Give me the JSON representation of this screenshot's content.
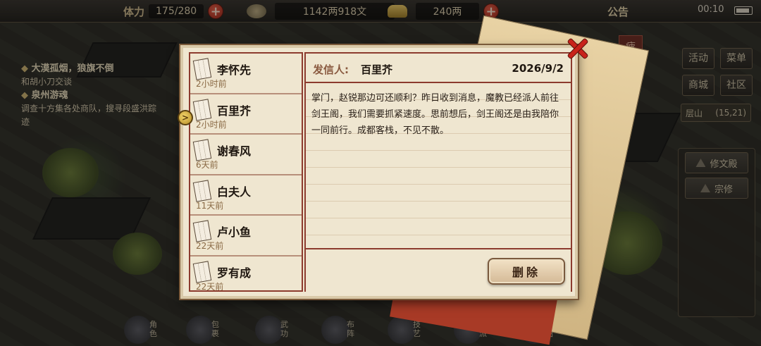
{
  "topbar": {
    "stamina_label": "体力",
    "stamina_value": "175/280",
    "money_value": "1142两918文",
    "gold_value": "240两",
    "notice_label": "公告",
    "clock": "00:10"
  },
  "quests": [
    {
      "title": "大漠孤烟，狼旗不倒",
      "desc": "和胡小刀交谈"
    },
    {
      "title": "泉州游魂",
      "desc": "调查十方集各处商队，搜寻段盛洪踪迹"
    }
  ],
  "right_menu": {
    "fatigue": "疲",
    "activity": "活动",
    "menu": "菜单",
    "shop": "商城",
    "community": "社区",
    "location_name": "层山",
    "location_coords": "(15,21)",
    "build_hall": "修文殿",
    "sect_cultivate": "宗修"
  },
  "bottom_nav": [
    {
      "label": "角色"
    },
    {
      "label": "包裹"
    },
    {
      "label": "武功"
    },
    {
      "label": "布阵"
    },
    {
      "label": "技艺"
    },
    {
      "label": "门派"
    },
    {
      "label": "地图"
    }
  ],
  "mail": {
    "list": [
      {
        "sender": "李怀先",
        "time": "2小时前"
      },
      {
        "sender": "百里芥",
        "time": "2小时前"
      },
      {
        "sender": "谢春风",
        "time": "6天前"
      },
      {
        "sender": "白夫人",
        "time": "11天前"
      },
      {
        "sender": "卢小鱼",
        "time": "22天前"
      },
      {
        "sender": "罗有成",
        "time": "22天前"
      }
    ],
    "selected_index": 1,
    "detail": {
      "sender_label": "发信人:",
      "sender_name": "百里芥",
      "date": "2026/9/2",
      "body": "掌门，赵锐那边可还顺利？昨日收到消息，魔教已经派人前往剑王阁，我们需要抓紧速度。思前想后，剑王阁还是由我陪你一同前行。成都客栈，不见不散。"
    },
    "delete_label": "删除"
  }
}
